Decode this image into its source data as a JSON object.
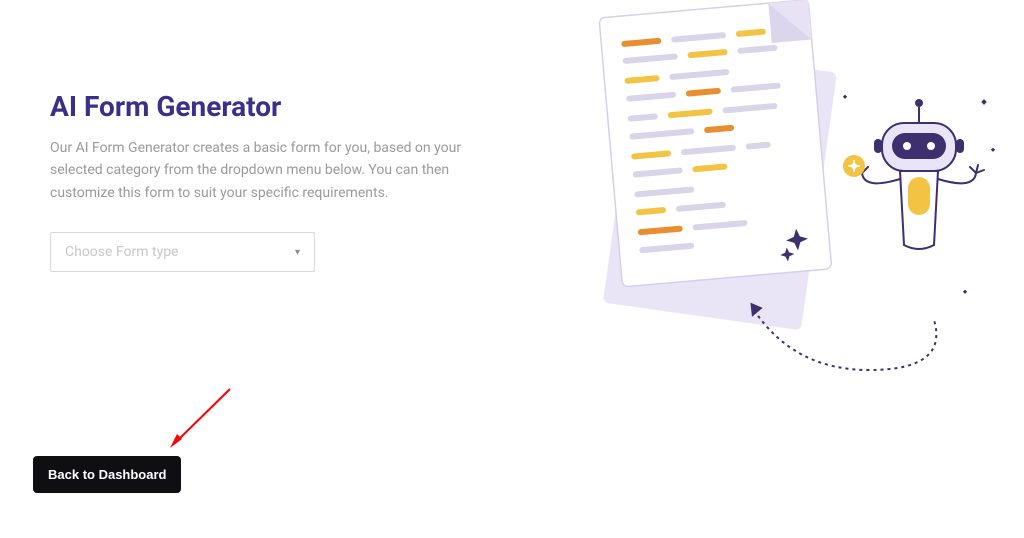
{
  "header": {
    "title": "AI Form Generator",
    "description": "Our AI Form Generator creates a basic form for you, based on your selected category from the dropdown menu below. You can then customize this form to suit your specific requirements."
  },
  "form": {
    "dropdown_placeholder": "Choose Form type"
  },
  "buttons": {
    "back_label": "Back to Dashboard"
  },
  "icons": {
    "caret": "chevron-down",
    "illustration": "document-robot-illustration",
    "annotation": "red-arrow-pointer"
  }
}
